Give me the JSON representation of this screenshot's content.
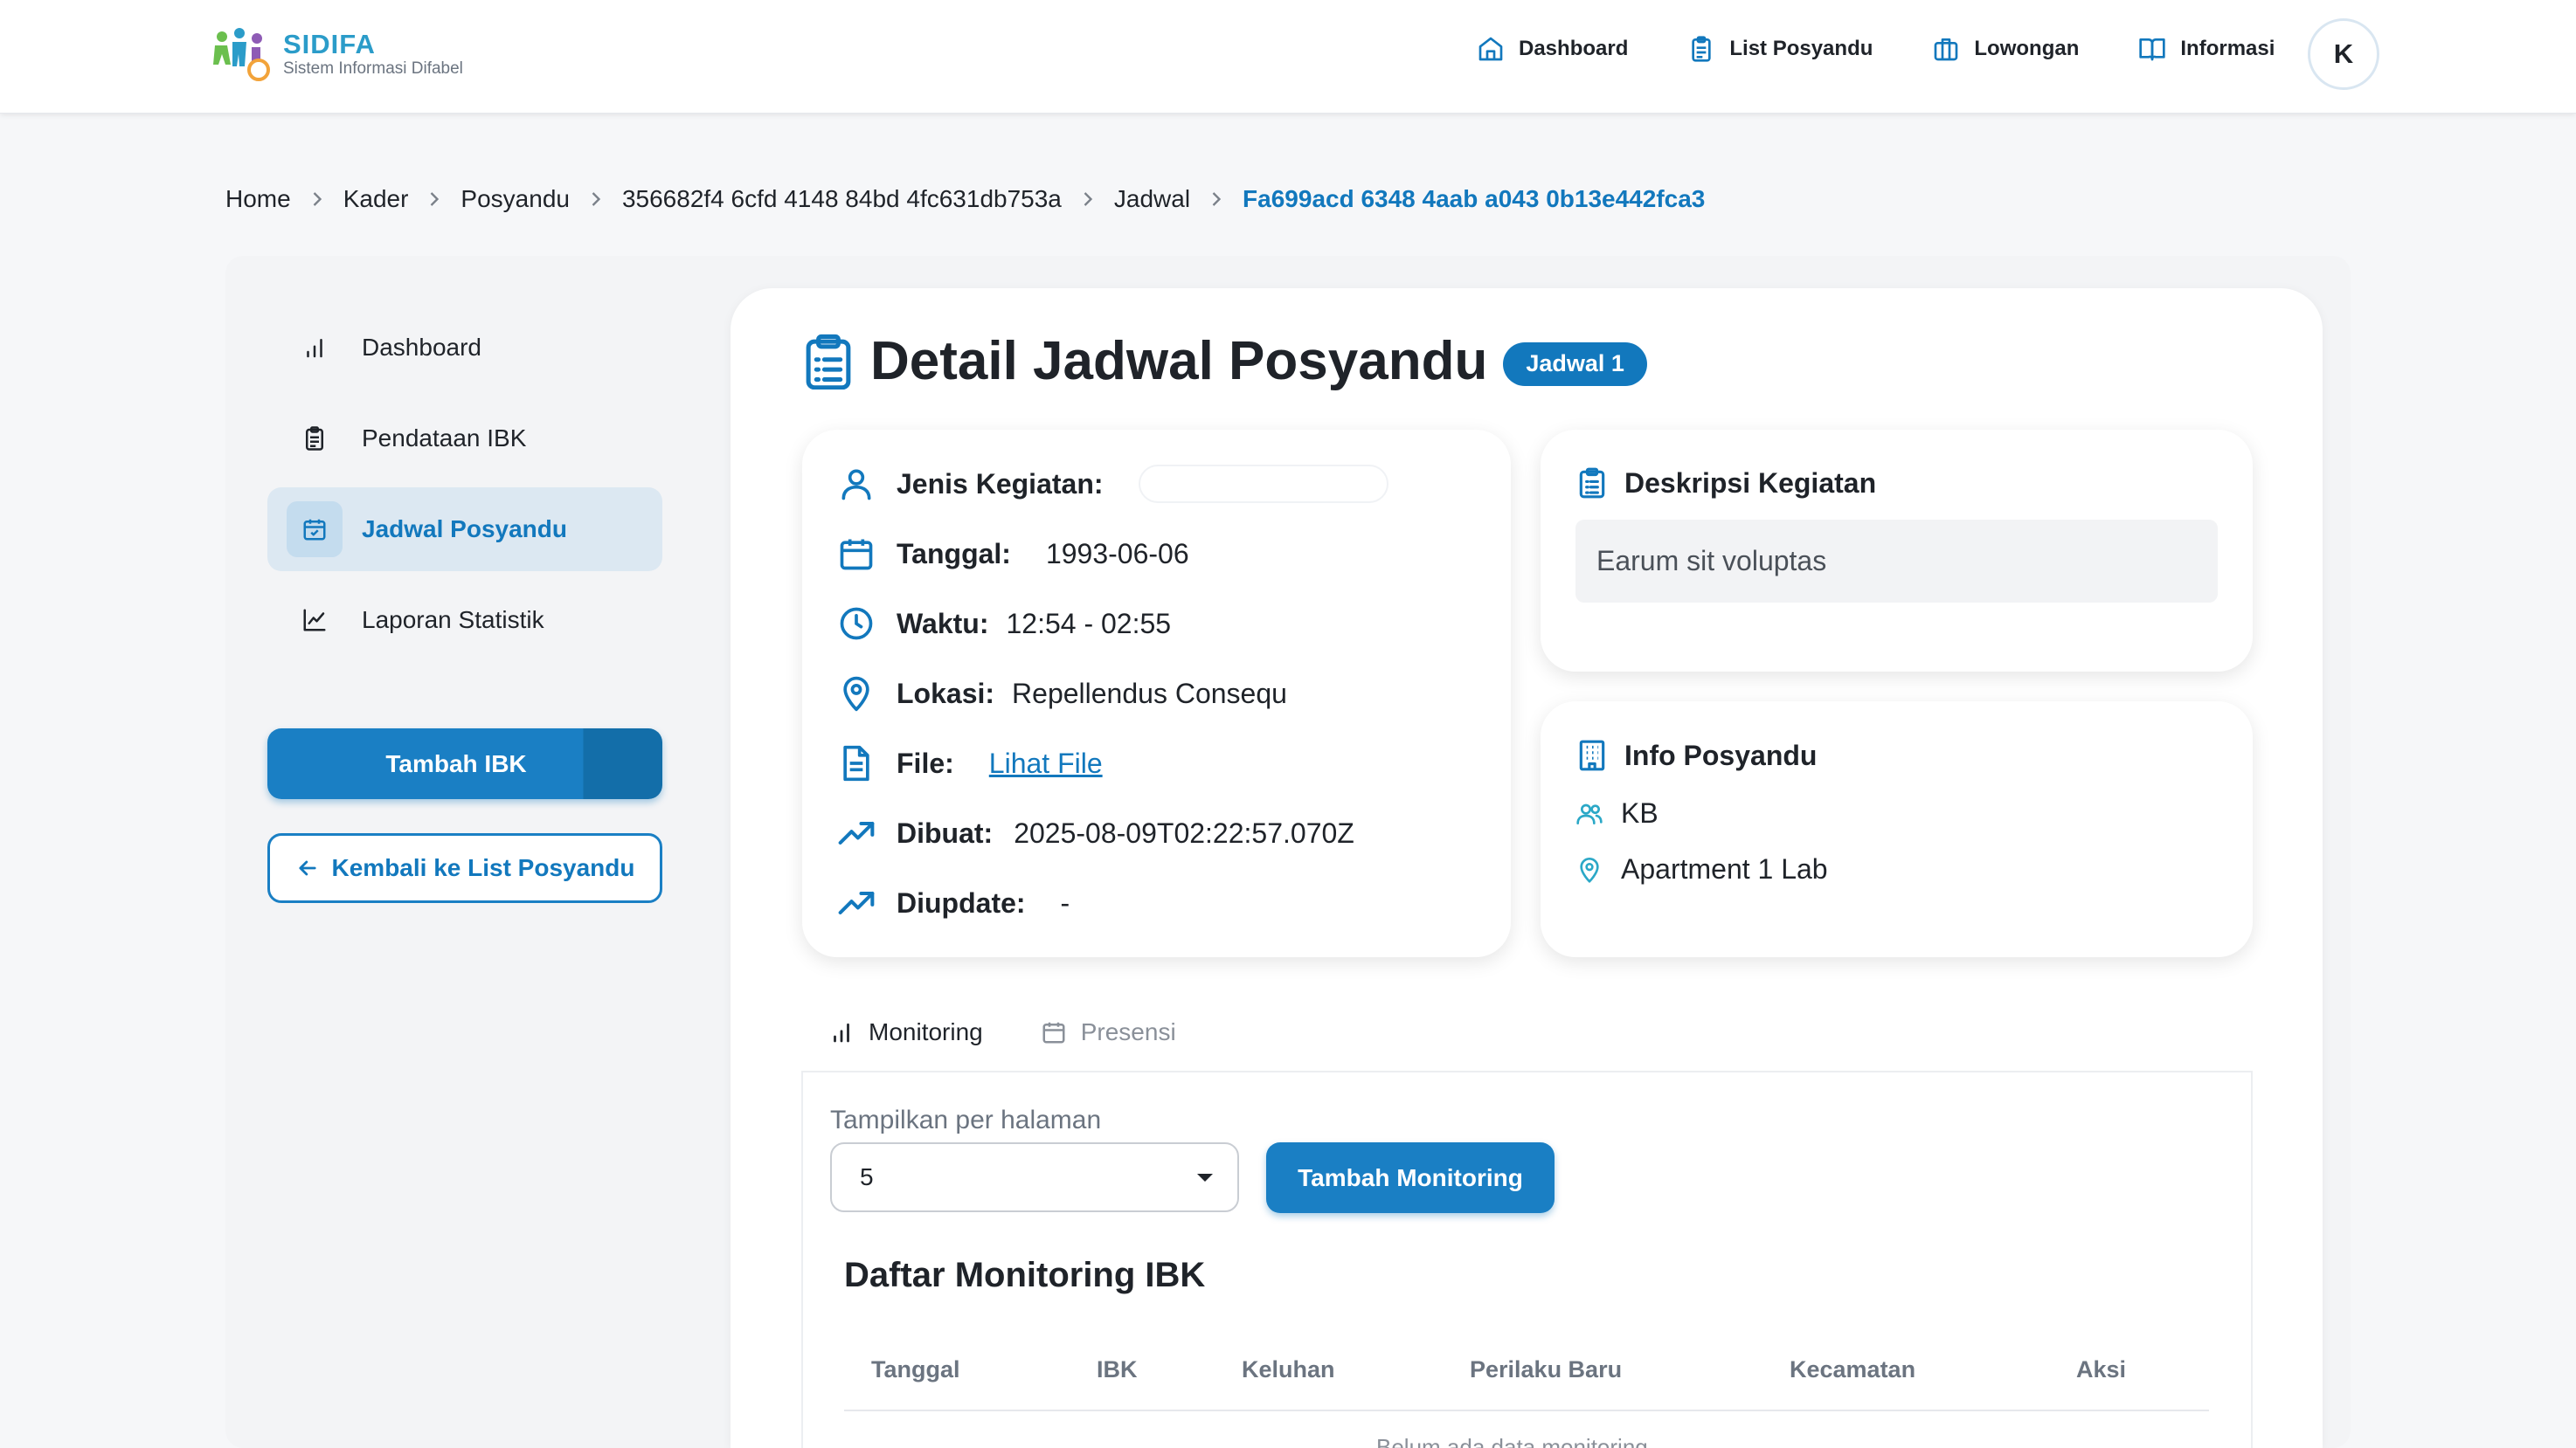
{
  "brand": {
    "name": "SIDIFA",
    "subtitle": "Sistem Informasi Difabel"
  },
  "nav": {
    "links": [
      {
        "label": "Dashboard",
        "icon": "home-icon"
      },
      {
        "label": "List Posyandu",
        "icon": "clipboard-icon"
      },
      {
        "label": "Lowongan",
        "icon": "briefcase-icon"
      },
      {
        "label": "Informasi",
        "icon": "book-icon"
      }
    ],
    "avatar_initial": "K"
  },
  "breadcrumb": [
    "Home",
    "Kader",
    "Posyandu",
    "356682f4 6cfd 4148 84bd 4fc631db753a",
    "Jadwal",
    "Fa699acd 6348 4aab a043 0b13e442fca3"
  ],
  "sidebar": {
    "items": [
      {
        "label": "Dashboard",
        "icon": "bar-chart-icon",
        "active": false
      },
      {
        "label": "Pendataan IBK",
        "icon": "clipboard-icon",
        "active": false
      },
      {
        "label": "Jadwal Posyandu",
        "icon": "calendar-check-icon",
        "active": true
      },
      {
        "label": "Laporan Statistik",
        "icon": "line-chart-icon",
        "active": false
      }
    ],
    "add_button": "Tambah IBK",
    "back_button": "Kembali ke List Posyandu"
  },
  "page": {
    "title": "Detail Jadwal Posyandu",
    "badge": "Jadwal 1"
  },
  "detail": {
    "jenis_label": "Jenis Kegiatan:",
    "jenis_value": "",
    "tanggal_label": "Tanggal:",
    "tanggal_value": "1993-06-06",
    "waktu_label": "Waktu:",
    "waktu_value": "12:54 - 02:55",
    "lokasi_label": "Lokasi:",
    "lokasi_value": "Repellendus Consequ",
    "file_label": "File:",
    "file_value": "Lihat File",
    "dibuat_label": "Dibuat:",
    "dibuat_value": "2025-08-09T02:22:57.070Z",
    "diupdate_label": "Diupdate:",
    "diupdate_value": "-"
  },
  "description": {
    "title": "Deskripsi Kegiatan",
    "text": "Earum sit voluptas"
  },
  "posyandu_info": {
    "title": "Info Posyandu",
    "name": "KB",
    "location": "Apartment 1 Lab"
  },
  "tabs": [
    {
      "label": "Monitoring",
      "active": true
    },
    {
      "label": "Presensi",
      "active": false
    }
  ],
  "table": {
    "per_page_label": "Tampilkan per halaman",
    "per_page_value": "5",
    "add_button": "Tambah Monitoring",
    "title": "Daftar Monitoring IBK",
    "headers": [
      "Tanggal",
      "IBK",
      "Keluhan",
      "Perilaku Baru",
      "Kecamatan",
      "Aksi"
    ],
    "empty_text": "Belum ada data monitoring"
  },
  "colors": {
    "primary": "#1278bd",
    "brand": "#2b9cc9",
    "background": "#f6f7f9"
  }
}
